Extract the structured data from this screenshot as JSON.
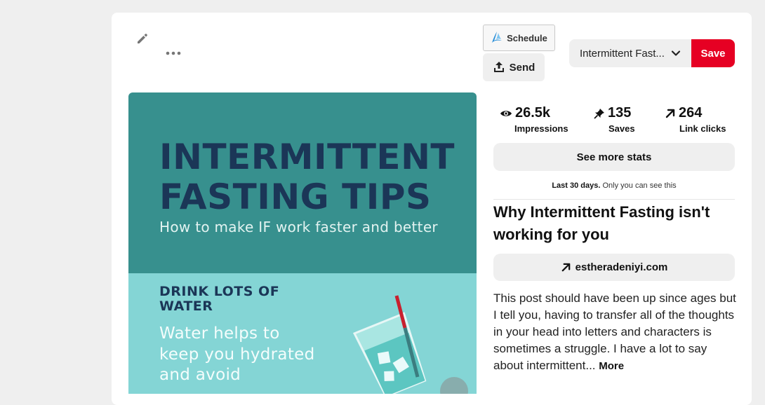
{
  "toolbar": {
    "edit_icon": "pencil-icon",
    "more_icon": "ellipsis-icon",
    "schedule_label": "Schedule",
    "schedule_icon": "tailwind-logo-icon",
    "send_label": "Send",
    "send_icon": "share-upload-icon",
    "board_name": "Intermittent Fast...",
    "board_chevron_icon": "chevron-down-icon",
    "save_label": "Save",
    "save_color": "#e60023"
  },
  "pin_image": {
    "title_line1": "INTERMITTENT",
    "title_line2": "FASTING TIPS",
    "subtitle": "How to make IF work faster and better",
    "tip_heading_line1": "DRINK LOTS OF",
    "tip_heading_line2": "WATER",
    "tip_body_line1": "Water helps to",
    "tip_body_line2": "keep you hydrated",
    "tip_body_line3": "and avoid",
    "top_color": "#37908e",
    "bottom_color": "#84d5d5",
    "title_color": "#1b3657"
  },
  "stats": {
    "impressions": {
      "value": "26.5k",
      "label": "Impressions",
      "icon": "eye-icon"
    },
    "saves": {
      "value": "135",
      "label": "Saves",
      "icon": "pin-icon"
    },
    "link_clicks": {
      "value": "264",
      "label": "Link clicks",
      "icon": "arrow-up-right-icon"
    }
  },
  "see_more_label": "See more stats",
  "note": {
    "bold": "Last 30 days.",
    "rest": " Only you can see this"
  },
  "pin_headline": "Why Intermittent Fasting isn't working for you",
  "link": {
    "label": "estheradeniyi.com",
    "icon": "arrow-up-right-icon"
  },
  "description": {
    "text": "This post should have been up since ages but I tell you, having to transfer all of the thoughts in your head into letters and characters is sometimes a struggle. I have a lot to say about intermittent...",
    "more_label": "More"
  }
}
